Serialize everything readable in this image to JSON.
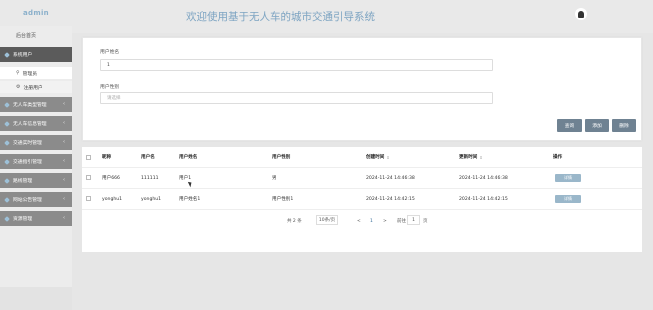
{
  "header": {
    "logo": "admin",
    "title": "欢迎使用基于无人车的城市交通引导系统"
  },
  "sidebar": {
    "home": "后台首页",
    "menus": [
      {
        "label": "系统用户",
        "active": true
      },
      {
        "label": "无人车类型管理"
      },
      {
        "label": "无人车信息管理"
      },
      {
        "label": "交通实时管理"
      },
      {
        "label": "交通指引管理"
      },
      {
        "label": "路线管理"
      },
      {
        "label": "网站公告管理"
      },
      {
        "label": "资源管理"
      }
    ],
    "submenus": [
      {
        "label": "管理员",
        "icon": "person-icon"
      },
      {
        "label": "注册用户",
        "icon": "gear-icon"
      }
    ]
  },
  "search": {
    "name_label": "用户姓名",
    "name_value": "1",
    "gender_label": "用户性别",
    "gender_placeholder": "请选择",
    "buttons": [
      "查询",
      "添加",
      "删除"
    ]
  },
  "table": {
    "headers": [
      "昵称",
      "用户名",
      "用户姓名",
      "用户性别",
      "创建时间",
      "更新时间",
      "操作"
    ],
    "rows": [
      {
        "nickname": "用户666",
        "username": "111111",
        "realname": "用户1",
        "gender": "男",
        "created": "2024-11-24 14:46:38",
        "updated": "2024-11-24 14:46:38",
        "action": "详情"
      },
      {
        "nickname": "yonghu1",
        "username": "yonghu1",
        "realname": "用户姓名1",
        "gender": "用户性别1",
        "created": "2024-11-24 14:42:15",
        "updated": "2024-11-24 14:42:15",
        "action": "详情"
      }
    ]
  },
  "pager": {
    "total": "共 2 条",
    "page_size": "10条/页",
    "prev": "<",
    "current": "1",
    "next": ">",
    "goto_prefix": "前往",
    "goto_value": "1",
    "goto_suffix": "页"
  }
}
